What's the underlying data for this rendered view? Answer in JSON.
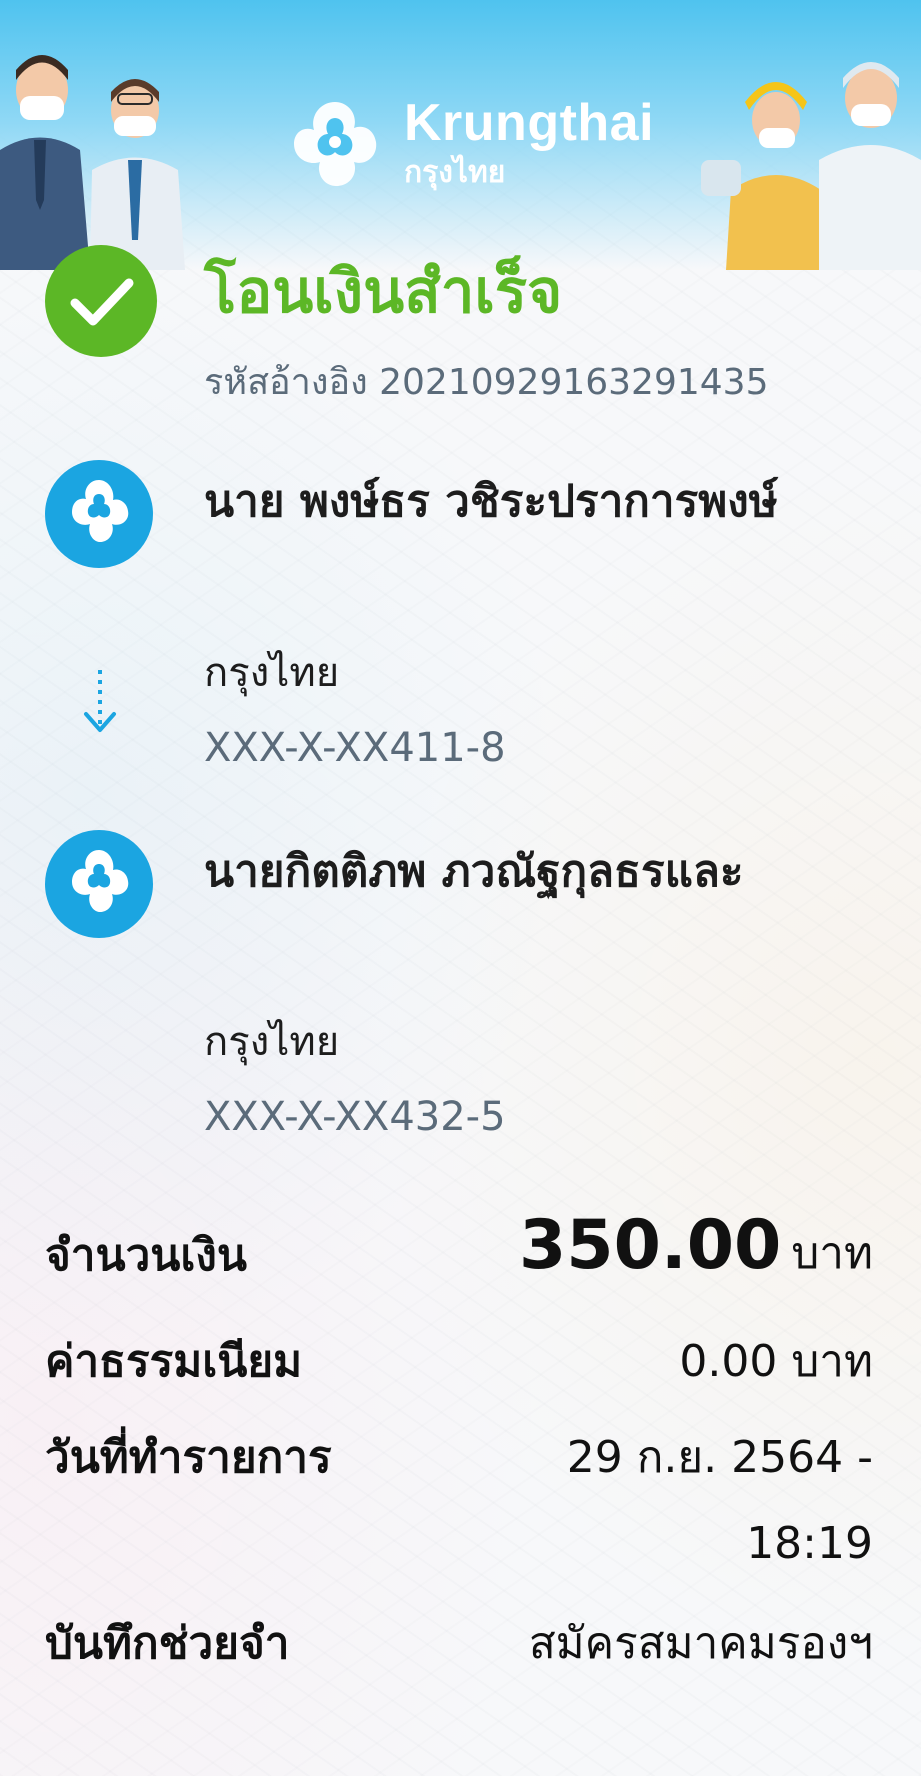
{
  "brand": {
    "name": "Krungthai",
    "thai_name": "กรุงไทย",
    "logo_icon": "krungthai-garuda-logo"
  },
  "status": {
    "icon": "check-circle-icon",
    "title": "โอนเงินสำเร็จ",
    "reference_label": "รหัสอ้างอิง",
    "reference_number": "20210929163291435"
  },
  "sender": {
    "name": "นาย พงษ์ธร วชิระปราการพงษ์",
    "bank": "กรุงไทย",
    "account": "XXX-X-XX411-8"
  },
  "recipient": {
    "name": "นายกิตติภพ ภวณัฐกุลธรและ",
    "bank": "กรุงไทย",
    "account": "XXX-X-XX432-5"
  },
  "details": {
    "amount_label": "จำนวนเงิน",
    "amount_value": "350.00",
    "amount_unit": "บาท",
    "fee_label": "ค่าธรรมเนียม",
    "fee_value": "0.00 บาท",
    "date_label": "วันที่ทำรายการ",
    "date_value": "29 ก.ย. 2564 -",
    "time_value": "18:19",
    "memo_label": "บันทึกช่วยจำ",
    "memo_value": "สมัครสมาคมรองฯ"
  },
  "colors": {
    "success_green": "#5cb726",
    "brand_blue": "#1ba5e1",
    "muted_text": "#5b6b7a",
    "header_blue": "#4fc3ef"
  }
}
